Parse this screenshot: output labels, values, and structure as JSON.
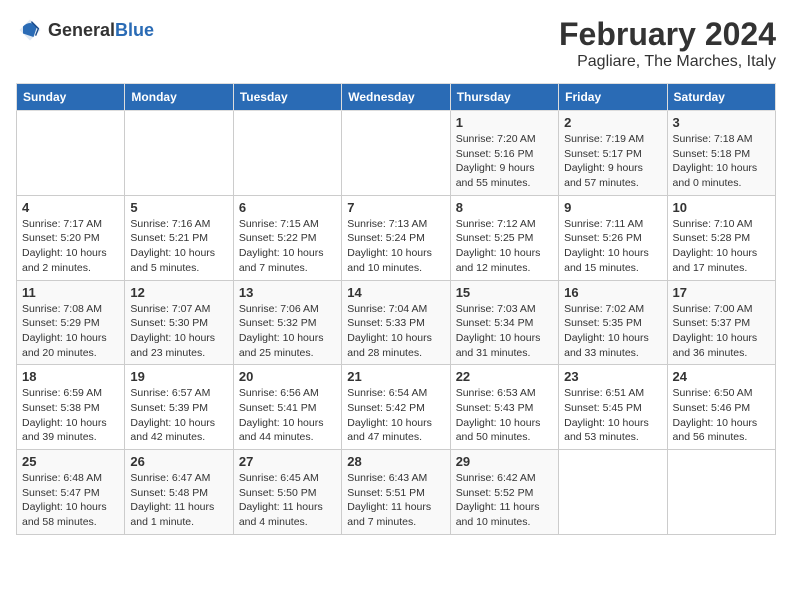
{
  "logo": {
    "text_general": "General",
    "text_blue": "Blue"
  },
  "title": {
    "month": "February 2024",
    "location": "Pagliare, The Marches, Italy"
  },
  "days_of_week": [
    "Sunday",
    "Monday",
    "Tuesday",
    "Wednesday",
    "Thursday",
    "Friday",
    "Saturday"
  ],
  "weeks": [
    [
      {
        "day": "",
        "info": ""
      },
      {
        "day": "",
        "info": ""
      },
      {
        "day": "",
        "info": ""
      },
      {
        "day": "",
        "info": ""
      },
      {
        "day": "1",
        "info": "Sunrise: 7:20 AM\nSunset: 5:16 PM\nDaylight: 9 hours and 55 minutes."
      },
      {
        "day": "2",
        "info": "Sunrise: 7:19 AM\nSunset: 5:17 PM\nDaylight: 9 hours and 57 minutes."
      },
      {
        "day": "3",
        "info": "Sunrise: 7:18 AM\nSunset: 5:18 PM\nDaylight: 10 hours and 0 minutes."
      }
    ],
    [
      {
        "day": "4",
        "info": "Sunrise: 7:17 AM\nSunset: 5:20 PM\nDaylight: 10 hours and 2 minutes."
      },
      {
        "day": "5",
        "info": "Sunrise: 7:16 AM\nSunset: 5:21 PM\nDaylight: 10 hours and 5 minutes."
      },
      {
        "day": "6",
        "info": "Sunrise: 7:15 AM\nSunset: 5:22 PM\nDaylight: 10 hours and 7 minutes."
      },
      {
        "day": "7",
        "info": "Sunrise: 7:13 AM\nSunset: 5:24 PM\nDaylight: 10 hours and 10 minutes."
      },
      {
        "day": "8",
        "info": "Sunrise: 7:12 AM\nSunset: 5:25 PM\nDaylight: 10 hours and 12 minutes."
      },
      {
        "day": "9",
        "info": "Sunrise: 7:11 AM\nSunset: 5:26 PM\nDaylight: 10 hours and 15 minutes."
      },
      {
        "day": "10",
        "info": "Sunrise: 7:10 AM\nSunset: 5:28 PM\nDaylight: 10 hours and 17 minutes."
      }
    ],
    [
      {
        "day": "11",
        "info": "Sunrise: 7:08 AM\nSunset: 5:29 PM\nDaylight: 10 hours and 20 minutes."
      },
      {
        "day": "12",
        "info": "Sunrise: 7:07 AM\nSunset: 5:30 PM\nDaylight: 10 hours and 23 minutes."
      },
      {
        "day": "13",
        "info": "Sunrise: 7:06 AM\nSunset: 5:32 PM\nDaylight: 10 hours and 25 minutes."
      },
      {
        "day": "14",
        "info": "Sunrise: 7:04 AM\nSunset: 5:33 PM\nDaylight: 10 hours and 28 minutes."
      },
      {
        "day": "15",
        "info": "Sunrise: 7:03 AM\nSunset: 5:34 PM\nDaylight: 10 hours and 31 minutes."
      },
      {
        "day": "16",
        "info": "Sunrise: 7:02 AM\nSunset: 5:35 PM\nDaylight: 10 hours and 33 minutes."
      },
      {
        "day": "17",
        "info": "Sunrise: 7:00 AM\nSunset: 5:37 PM\nDaylight: 10 hours and 36 minutes."
      }
    ],
    [
      {
        "day": "18",
        "info": "Sunrise: 6:59 AM\nSunset: 5:38 PM\nDaylight: 10 hours and 39 minutes."
      },
      {
        "day": "19",
        "info": "Sunrise: 6:57 AM\nSunset: 5:39 PM\nDaylight: 10 hours and 42 minutes."
      },
      {
        "day": "20",
        "info": "Sunrise: 6:56 AM\nSunset: 5:41 PM\nDaylight: 10 hours and 44 minutes."
      },
      {
        "day": "21",
        "info": "Sunrise: 6:54 AM\nSunset: 5:42 PM\nDaylight: 10 hours and 47 minutes."
      },
      {
        "day": "22",
        "info": "Sunrise: 6:53 AM\nSunset: 5:43 PM\nDaylight: 10 hours and 50 minutes."
      },
      {
        "day": "23",
        "info": "Sunrise: 6:51 AM\nSunset: 5:45 PM\nDaylight: 10 hours and 53 minutes."
      },
      {
        "day": "24",
        "info": "Sunrise: 6:50 AM\nSunset: 5:46 PM\nDaylight: 10 hours and 56 minutes."
      }
    ],
    [
      {
        "day": "25",
        "info": "Sunrise: 6:48 AM\nSunset: 5:47 PM\nDaylight: 10 hours and 58 minutes."
      },
      {
        "day": "26",
        "info": "Sunrise: 6:47 AM\nSunset: 5:48 PM\nDaylight: 11 hours and 1 minute."
      },
      {
        "day": "27",
        "info": "Sunrise: 6:45 AM\nSunset: 5:50 PM\nDaylight: 11 hours and 4 minutes."
      },
      {
        "day": "28",
        "info": "Sunrise: 6:43 AM\nSunset: 5:51 PM\nDaylight: 11 hours and 7 minutes."
      },
      {
        "day": "29",
        "info": "Sunrise: 6:42 AM\nSunset: 5:52 PM\nDaylight: 11 hours and 10 minutes."
      },
      {
        "day": "",
        "info": ""
      },
      {
        "day": "",
        "info": ""
      }
    ]
  ]
}
